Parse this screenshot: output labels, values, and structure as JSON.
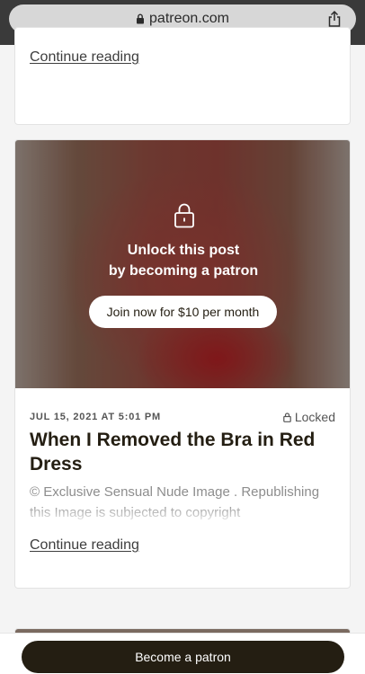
{
  "browser": {
    "url": "patreon.com",
    "lock_icon": "padlock-icon",
    "share_icon": "share-icon"
  },
  "posts": [
    {
      "continue_label": "Continue reading"
    },
    {
      "lock_overlay": {
        "icon": "padlock-icon",
        "line1": "Unlock this post",
        "line2": "by becoming a patron",
        "join_label": "Join now for $10 per month"
      },
      "date": "JUL 15, 2021 AT 5:01 PM",
      "locked_label": "Locked",
      "title": "When I Removed the Bra in Red Dress",
      "excerpt": "© Exclusive Sensual Nude Image . Republishing this Image is subjected to copyright",
      "continue_label": "Continue reading"
    }
  ],
  "footer": {
    "become_label": "Become a patron"
  },
  "colors": {
    "brand_dark": "#241e12",
    "browser_bar": "#3a3a3a",
    "url_pill": "#d7d7d7"
  }
}
